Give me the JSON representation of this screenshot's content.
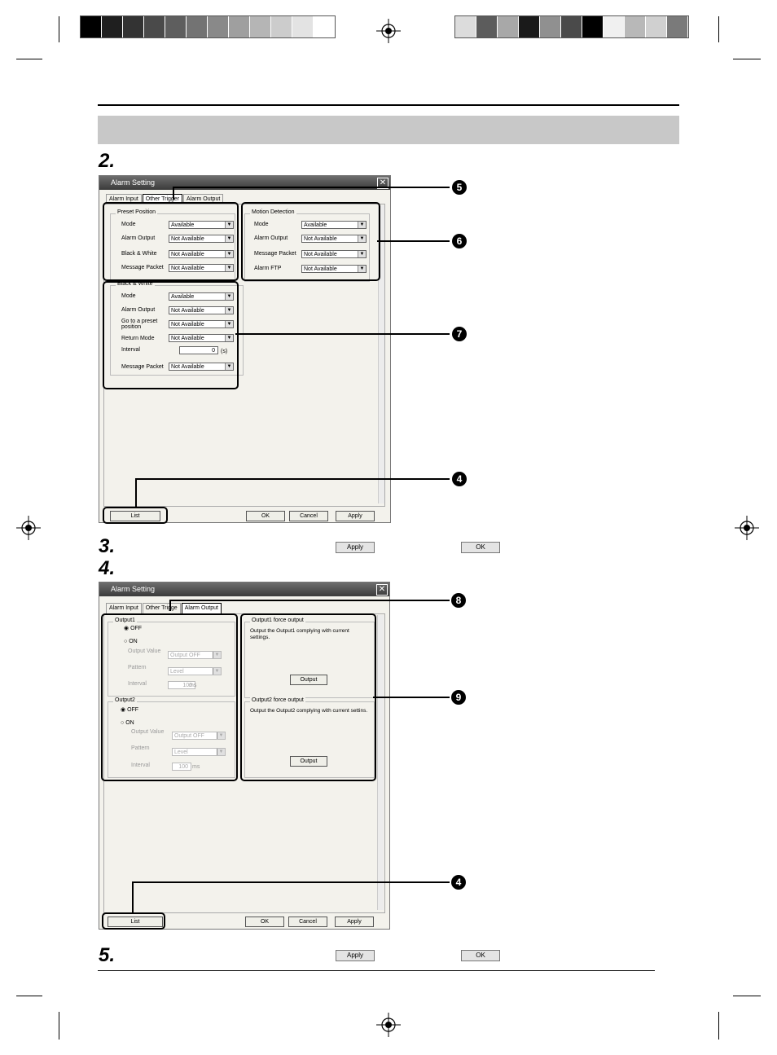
{
  "print_marks": {
    "left_swatches": [
      "#000000",
      "#1f1f1f",
      "#333333",
      "#4a4a4a",
      "#5e5e5e",
      "#737373",
      "#898989",
      "#9f9f9f",
      "#b5b5b5",
      "#cccccc",
      "#e3e3e3",
      "#ffffff"
    ],
    "right_swatches": [
      "#dcdcdc",
      "#5c5c5c",
      "#a8a8a8",
      "#1a1a1a",
      "#909090",
      "#4a4a4a",
      "#000000",
      "#f0f0f0",
      "#b8b8b8",
      "#d0d0d0",
      "#7a7a7a"
    ]
  },
  "steps": {
    "s2": "2.",
    "s3": "3.",
    "s4": "4.",
    "s5": "5."
  },
  "inline_buttons": {
    "apply": "Apply",
    "ok": "OK"
  },
  "dialog1": {
    "title": "Alarm Setting",
    "close": "✕",
    "tabs": [
      "Alarm Input",
      "Other Trigger",
      "Alarm Output"
    ],
    "preset": {
      "label": "Preset Position",
      "fields": [
        {
          "label": "Mode",
          "value": "Available"
        },
        {
          "label": "Alarm Output",
          "value": "Not Available"
        },
        {
          "label": "Black & White",
          "value": "Not Available"
        },
        {
          "label": "Message Packet",
          "value": "Not Available"
        }
      ]
    },
    "motion": {
      "label": "Motion Detection",
      "fields": [
        {
          "label": "Mode",
          "value": "Available"
        },
        {
          "label": "Alarm Output",
          "value": "Not Available"
        },
        {
          "label": "Message Packet",
          "value": "Not Available"
        },
        {
          "label": "Alarm FTP",
          "value": "Not Available"
        }
      ]
    },
    "bw": {
      "label": "Black & White",
      "fields": [
        {
          "label": "Mode",
          "value": "Available"
        },
        {
          "label": "Alarm Output",
          "value": "Not Available"
        },
        {
          "label": "Go to a preset position",
          "value": "Not Available"
        },
        {
          "label": "Return Mode",
          "value": "Not Available"
        },
        {
          "label": "Interval",
          "value": "0"
        },
        {
          "label": "Message Packet",
          "value": "Not Available"
        }
      ],
      "unit": "(s)"
    },
    "buttons": {
      "list": "List",
      "ok": "OK",
      "cancel": "Cancel",
      "apply": "Apply"
    }
  },
  "dialog2": {
    "title": "Alarm Setting",
    "close": "✕",
    "tabs": [
      "Alarm Input",
      "Other Trigge",
      "Alarm Output"
    ],
    "output1": {
      "label": "Output1",
      "off": "OFF",
      "on": "ON",
      "value_label": "Output Value",
      "value": "Output OFF",
      "pattern_label": "Pattern",
      "pattern": "Level",
      "interval_label": "Interval",
      "interval": "100",
      "interval_unit": "ms"
    },
    "output2": {
      "label": "Output2",
      "off": "OFF",
      "on": "ON",
      "value_label": "Output Value",
      "value": "Output OFF",
      "pattern_label": "Pattern",
      "pattern": "Level",
      "interval_label": "Interval",
      "interval": "100",
      "interval_unit": "ms"
    },
    "force1": {
      "label": "Output1 force output",
      "text": "Output the Output1 complying with current settings.",
      "button": "Output"
    },
    "force2": {
      "label": "Output2 force output",
      "text": "Output the Output2 complying with current settins.",
      "button": "Output"
    },
    "buttons": {
      "list": "List",
      "ok": "OK",
      "cancel": "Cancel",
      "apply": "Apply"
    }
  },
  "badges": {
    "b5": "5",
    "b6": "6",
    "b7": "7",
    "b4a": "4",
    "b8": "8",
    "b9": "9",
    "b4b": "4"
  }
}
